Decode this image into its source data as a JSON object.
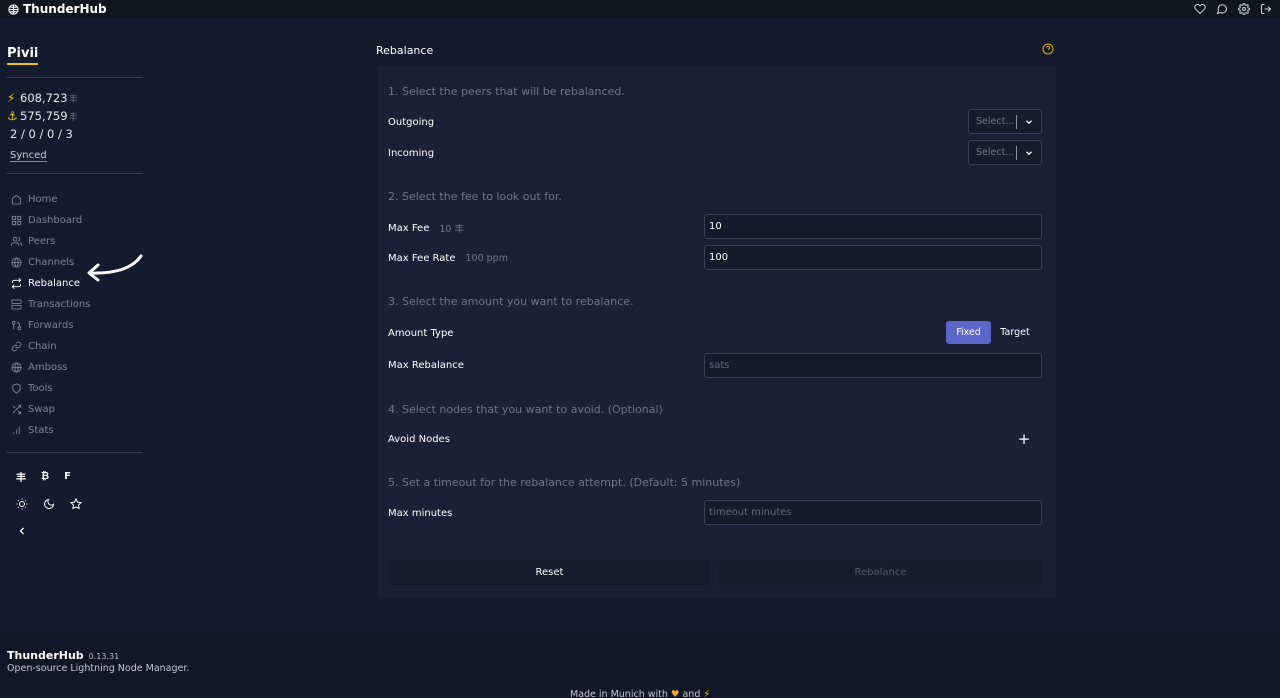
{
  "app": {
    "name": "ThunderHub"
  },
  "topbar": {
    "icons": [
      "heart-icon",
      "chat-icon",
      "settings-icon",
      "logout-icon"
    ]
  },
  "sidebar": {
    "node_name": "Pivii",
    "lightning_balance": "608,723",
    "chain_balance": "575,759",
    "balance_unit": "丰",
    "channel_counts": "2 / 0 / 0 / 3",
    "sync_status": "Synced",
    "items": [
      {
        "label": "Home",
        "icon": "home-icon"
      },
      {
        "label": "Dashboard",
        "icon": "grid-icon"
      },
      {
        "label": "Peers",
        "icon": "users-icon"
      },
      {
        "label": "Channels",
        "icon": "globe-icon"
      },
      {
        "label": "Rebalance",
        "icon": "repeat-icon",
        "active": true
      },
      {
        "label": "Transactions",
        "icon": "server-icon"
      },
      {
        "label": "Forwards",
        "icon": "git-pull-icon"
      },
      {
        "label": "Chain",
        "icon": "link-icon"
      },
      {
        "label": "Amboss",
        "icon": "globe-icon"
      },
      {
        "label": "Tools",
        "icon": "shield-icon"
      },
      {
        "label": "Swap",
        "icon": "shuffle-icon"
      },
      {
        "label": "Stats",
        "icon": "bar-chart-icon"
      }
    ],
    "currency_options": [
      "丰",
      "₿",
      "F"
    ]
  },
  "main": {
    "title": "Rebalance",
    "step1": "1. Select the peers that will be rebalanced.",
    "outgoing_label": "Outgoing",
    "incoming_label": "Incoming",
    "select_placeholder": "Select...",
    "step2": "2. Select the fee to look out for.",
    "max_fee_label": "Max Fee",
    "max_fee_sub": "10 丰",
    "max_fee_value": "10",
    "max_fee_rate_label": "Max Fee Rate",
    "max_fee_rate_sub": "100 ppm",
    "max_fee_rate_value": "100",
    "step3": "3. Select the amount you want to rebalance.",
    "amount_type_label": "Amount Type",
    "amount_fixed": "Fixed",
    "amount_target": "Target",
    "max_rebalance_label": "Max Rebalance",
    "max_rebalance_placeholder": "sats",
    "step4": "4. Select nodes that you want to avoid. (Optional)",
    "avoid_nodes_label": "Avoid Nodes",
    "step5": "5. Set a timeout for the rebalance attempt. (Default: 5 minutes)",
    "max_minutes_label": "Max minutes",
    "max_minutes_placeholder": "timeout minutes",
    "reset_label": "Reset",
    "rebalance_label": "Rebalance"
  },
  "footer": {
    "brand": "ThunderHub",
    "version": "0.13.31",
    "description": "Open-source Lightning Node Manager.",
    "made_in": "Made in Munich with",
    "and": "and"
  },
  "colors": {
    "background": "#151b2e",
    "card": "#1a2136",
    "accent": "#5a67c8",
    "brand_yellow": "#f5c400",
    "synced_green": "#4caf50"
  }
}
